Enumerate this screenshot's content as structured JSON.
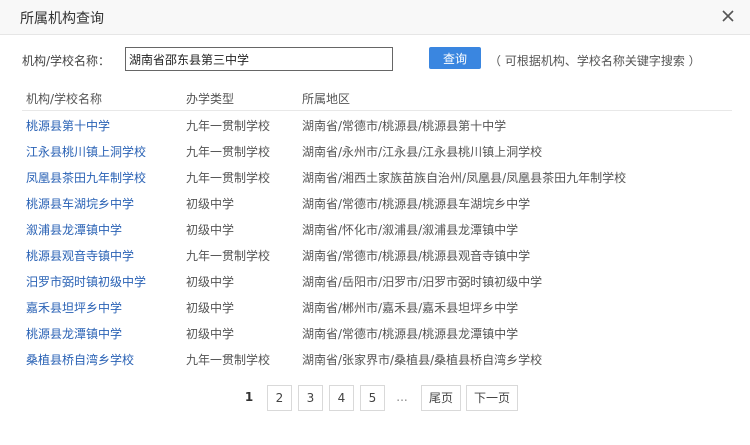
{
  "dialog": {
    "title": "所属机构查询"
  },
  "search": {
    "label": "机构/学校名称：",
    "value": "湖南省邵东县第三中学",
    "button_label": "查询",
    "hint": "（ 可根据机构、学校名称关键字搜索 ）"
  },
  "table": {
    "headers": [
      "机构/学校名称",
      "办学类型",
      "所属地区"
    ],
    "rows": [
      [
        "桃源县第十中学",
        "九年一贯制学校",
        "湖南省/常德市/桃源县/桃源县第十中学"
      ],
      [
        "江永县桃川镇上洞学校",
        "九年一贯制学校",
        "湖南省/永州市/江永县/江永县桃川镇上洞学校"
      ],
      [
        "凤凰县茶田九年制学校",
        "九年一贯制学校",
        "湖南省/湘西土家族苗族自治州/凤凰县/凤凰县茶田九年制学校"
      ],
      [
        "桃源县车湖垸乡中学",
        "初级中学",
        "湖南省/常德市/桃源县/桃源县车湖垸乡中学"
      ],
      [
        "溆浦县龙潭镇中学",
        "初级中学",
        "湖南省/怀化市/溆浦县/溆浦县龙潭镇中学"
      ],
      [
        "桃源县观音寺镇中学",
        "九年一贯制学校",
        "湖南省/常德市/桃源县/桃源县观音寺镇中学"
      ],
      [
        "汨罗市弼时镇初级中学",
        "初级中学",
        "湖南省/岳阳市/汨罗市/汨罗市弼时镇初级中学"
      ],
      [
        "嘉禾县坦坪乡中学",
        "初级中学",
        "湖南省/郴州市/嘉禾县/嘉禾县坦坪乡中学"
      ],
      [
        "桃源县龙潭镇中学",
        "初级中学",
        "湖南省/常德市/桃源县/桃源县龙潭镇中学"
      ],
      [
        "桑植县桥自湾乡学校",
        "九年一贯制学校",
        "湖南省/张家界市/桑植县/桑植县桥自湾乡学校"
      ]
    ]
  },
  "pagination": {
    "current": "1",
    "pages": [
      "2",
      "3",
      "4",
      "5"
    ],
    "ellipsis": "...",
    "last_label": "尾页",
    "next_label": "下一页"
  },
  "colors": {
    "accent": "#3a86e0",
    "link": "#2a62b5"
  }
}
